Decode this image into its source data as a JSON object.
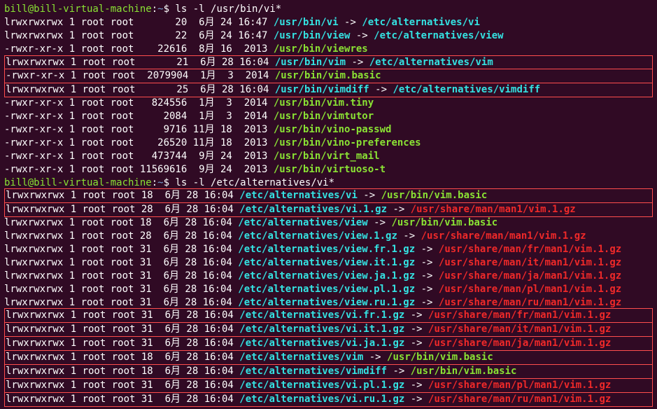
{
  "prompt1": {
    "user": "bill@bill-virtual-machine",
    "sep1": ":",
    "path": "~",
    "sep2": "$ ",
    "cmd": "ls -l /usr/bin/vi*"
  },
  "prompt2": {
    "user": "bill@bill-virtual-machine",
    "sep1": ":",
    "path": "~",
    "sep2": "$ ",
    "cmd": "ls -l /etc/alternatives/vi*"
  },
  "block1": [
    {
      "perm": "lrwxrwxrwx 1 root root       20  6月 24 16:47 ",
      "p": "/usr/bin/vi",
      "arrow": " -> ",
      "t": "/etc/alternatives/vi",
      "tc": "cyan",
      "box": false
    },
    {
      "perm": "lrwxrwxrwx 1 root root       22  6月 24 16:47 ",
      "p": "/usr/bin/view",
      "arrow": " -> ",
      "t": "/etc/alternatives/view",
      "tc": "cyan",
      "box": false
    },
    {
      "perm": "-rwxr-xr-x 1 root root    22616  8月 16  2013 ",
      "p": "/usr/bin/viewres",
      "pc": "green",
      "box": false
    },
    {
      "perm": "lrwxrwxrwx 1 root root       21  6月 28 16:04 ",
      "p": "/usr/bin/vim",
      "arrow": " -> ",
      "t": "/etc/alternatives/vim",
      "tc": "cyan",
      "box": true
    },
    {
      "perm": "-rwxr-xr-x 1 root root  2079904  1月  3  2014 ",
      "p": "/usr/bin/vim.basic",
      "pc": "green",
      "box": true
    },
    {
      "perm": "lrwxrwxrwx 1 root root       25  6月 28 16:04 ",
      "p": "/usr/bin/vimdiff",
      "arrow": " -> ",
      "t": "/etc/alternatives/vimdiff",
      "tc": "cyan",
      "box": true
    },
    {
      "perm": "-rwxr-xr-x 1 root root   824556  1月  3  2014 ",
      "p": "/usr/bin/vim.tiny",
      "pc": "green",
      "box": false
    },
    {
      "perm": "-rwxr-xr-x 1 root root     2084  1月  3  2014 ",
      "p": "/usr/bin/vimtutor",
      "pc": "green",
      "box": false
    },
    {
      "perm": "-rwxr-xr-x 1 root root     9716 11月 18  2013 ",
      "p": "/usr/bin/vino-passwd",
      "pc": "green",
      "box": false
    },
    {
      "perm": "-rwxr-xr-x 1 root root    26520 11月 18  2013 ",
      "p": "/usr/bin/vino-preferences",
      "pc": "green",
      "box": false
    },
    {
      "perm": "-rwxr-xr-x 1 root root   473744  9月 24  2013 ",
      "p": "/usr/bin/virt_mail",
      "pc": "green",
      "box": false
    },
    {
      "perm": "-rwxr-xr-x 1 root root 11569616  9月 24  2013 ",
      "p": "/usr/bin/virtuoso-t",
      "pc": "green",
      "box": false
    }
  ],
  "block2": [
    {
      "perm": "lrwxrwxrwx 1 root root 18  6月 28 16:04 ",
      "p": "/etc/alternatives/vi",
      "arrow": " -> ",
      "t": "/usr/bin/vim.basic",
      "tc": "green",
      "box": true
    },
    {
      "perm": "lrwxrwxrwx 1 root root 28  6月 28 16:04 ",
      "p": "/etc/alternatives/vi.1.gz",
      "arrow": " -> ",
      "t": "/usr/share/man/man1/vim.1.gz",
      "tc": "red",
      "box": true
    },
    {
      "perm": "lrwxrwxrwx 1 root root 18  6月 28 16:04 ",
      "p": "/etc/alternatives/view",
      "arrow": " -> ",
      "t": "/usr/bin/vim.basic",
      "tc": "green",
      "box": false
    },
    {
      "perm": "lrwxrwxrwx 1 root root 28  6月 28 16:04 ",
      "p": "/etc/alternatives/view.1.gz",
      "arrow": " -> ",
      "t": "/usr/share/man/man1/vim.1.gz",
      "tc": "red",
      "box": false
    },
    {
      "perm": "lrwxrwxrwx 1 root root 31  6月 28 16:04 ",
      "p": "/etc/alternatives/view.fr.1.gz",
      "arrow": " -> ",
      "t": "/usr/share/man/fr/man1/vim.1.gz",
      "tc": "red",
      "box": false
    },
    {
      "perm": "lrwxrwxrwx 1 root root 31  6月 28 16:04 ",
      "p": "/etc/alternatives/view.it.1.gz",
      "arrow": " -> ",
      "t": "/usr/share/man/it/man1/vim.1.gz",
      "tc": "red",
      "box": false
    },
    {
      "perm": "lrwxrwxrwx 1 root root 31  6月 28 16:04 ",
      "p": "/etc/alternatives/view.ja.1.gz",
      "arrow": " -> ",
      "t": "/usr/share/man/ja/man1/vim.1.gz",
      "tc": "red",
      "box": false
    },
    {
      "perm": "lrwxrwxrwx 1 root root 31  6月 28 16:04 ",
      "p": "/etc/alternatives/view.pl.1.gz",
      "arrow": " -> ",
      "t": "/usr/share/man/pl/man1/vim.1.gz",
      "tc": "red",
      "box": false
    },
    {
      "perm": "lrwxrwxrwx 1 root root 31  6月 28 16:04 ",
      "p": "/etc/alternatives/view.ru.1.gz",
      "arrow": " -> ",
      "t": "/usr/share/man/ru/man1/vim.1.gz",
      "tc": "red",
      "box": false
    },
    {
      "perm": "lrwxrwxrwx 1 root root 31  6月 28 16:04 ",
      "p": "/etc/alternatives/vi.fr.1.gz",
      "arrow": " -> ",
      "t": "/usr/share/man/fr/man1/vim.1.gz",
      "tc": "red",
      "box": true
    },
    {
      "perm": "lrwxrwxrwx 1 root root 31  6月 28 16:04 ",
      "p": "/etc/alternatives/vi.it.1.gz",
      "arrow": " -> ",
      "t": "/usr/share/man/it/man1/vim.1.gz",
      "tc": "red",
      "box": true
    },
    {
      "perm": "lrwxrwxrwx 1 root root 31  6月 28 16:04 ",
      "p": "/etc/alternatives/vi.ja.1.gz",
      "arrow": " -> ",
      "t": "/usr/share/man/ja/man1/vim.1.gz",
      "tc": "red",
      "box": true
    },
    {
      "perm": "lrwxrwxrwx 1 root root 18  6月 28 16:04 ",
      "p": "/etc/alternatives/vim",
      "arrow": " -> ",
      "t": "/usr/bin/vim.basic",
      "tc": "green",
      "box": true
    },
    {
      "perm": "lrwxrwxrwx 1 root root 18  6月 28 16:04 ",
      "p": "/etc/alternatives/vimdiff",
      "arrow": " -> ",
      "t": "/usr/bin/vim.basic",
      "tc": "green",
      "box": true
    },
    {
      "perm": "lrwxrwxrwx 1 root root 31  6月 28 16:04 ",
      "p": "/etc/alternatives/vi.pl.1.gz",
      "arrow": " -> ",
      "t": "/usr/share/man/pl/man1/vim.1.gz",
      "tc": "red",
      "box": true
    },
    {
      "perm": "lrwxrwxrwx 1 root root 31  6月 28 16:04 ",
      "p": "/etc/alternatives/vi.ru.1.gz",
      "arrow": " -> ",
      "t": "/usr/share/man/ru/man1/vim.1.gz",
      "tc": "red",
      "box": true
    }
  ]
}
